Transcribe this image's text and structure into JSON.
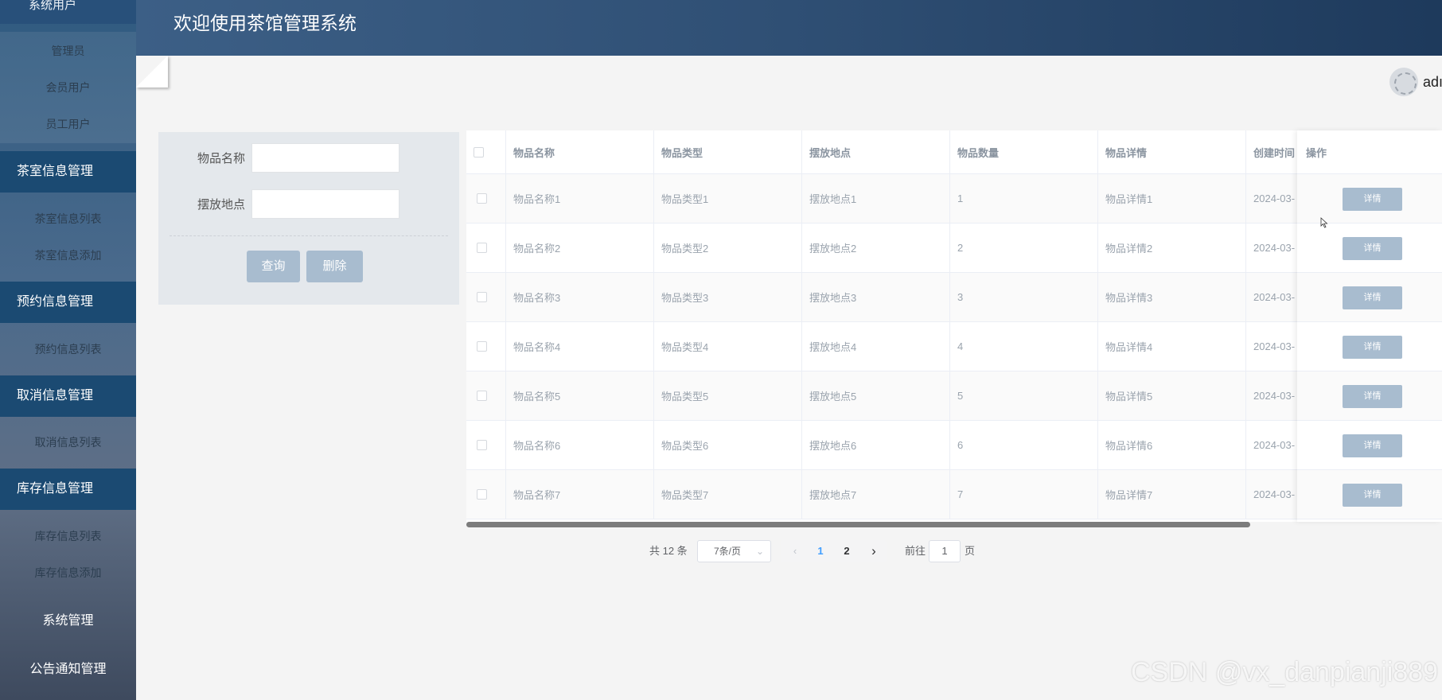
{
  "sidebar": {
    "top_item": "系统用户",
    "user_sub": [
      "管理员",
      "会员用户",
      "员工用户"
    ],
    "groups": [
      {
        "label": "茶室信息管理",
        "items": [
          "茶室信息列表",
          "茶室信息添加"
        ]
      },
      {
        "label": "预约信息管理",
        "items": [
          "预约信息列表"
        ]
      },
      {
        "label": "取消信息管理",
        "items": [
          "取消信息列表"
        ]
      },
      {
        "label": "库存信息管理",
        "items": [
          "库存信息列表",
          "库存信息添加"
        ]
      }
    ],
    "system": "系统管理",
    "notice": "公告通知管理"
  },
  "header": {
    "title": "欢迎使用茶馆管理系统"
  },
  "user": {
    "name": "adı"
  },
  "search": {
    "name_label": "物品名称",
    "name_value": "",
    "place_label": "摆放地点",
    "place_value": "",
    "query_btn": "查询",
    "delete_btn": "删除"
  },
  "table": {
    "headers": [
      "物品名称",
      "物品类型",
      "摆放地点",
      "物品数量",
      "物品详情",
      "创建时间",
      "操作"
    ],
    "rows": [
      {
        "name": "物品名称1",
        "type": "物品类型1",
        "place": "摆放地点1",
        "qty": "1",
        "detail": "物品详情1",
        "created": "2024-03-"
      },
      {
        "name": "物品名称2",
        "type": "物品类型2",
        "place": "摆放地点2",
        "qty": "2",
        "detail": "物品详情2",
        "created": "2024-03-"
      },
      {
        "name": "物品名称3",
        "type": "物品类型3",
        "place": "摆放地点3",
        "qty": "3",
        "detail": "物品详情3",
        "created": "2024-03-"
      },
      {
        "name": "物品名称4",
        "type": "物品类型4",
        "place": "摆放地点4",
        "qty": "4",
        "detail": "物品详情4",
        "created": "2024-03-"
      },
      {
        "name": "物品名称5",
        "type": "物品类型5",
        "place": "摆放地点5",
        "qty": "5",
        "detail": "物品详情5",
        "created": "2024-03-"
      },
      {
        "name": "物品名称6",
        "type": "物品类型6",
        "place": "摆放地点6",
        "qty": "6",
        "detail": "物品详情6",
        "created": "2024-03-"
      },
      {
        "name": "物品名称7",
        "type": "物品类型7",
        "place": "摆放地点7",
        "qty": "7",
        "detail": "物品详情7",
        "created": "2024-03-"
      }
    ],
    "detail_btn": "详情"
  },
  "pagination": {
    "total": "共 12 条",
    "page_size": "7条/页",
    "pages": [
      "1",
      "2"
    ],
    "current": "1",
    "jump_prefix": "前往",
    "jump_value": "1",
    "jump_suffix": "页"
  },
  "watermark": "CSDN @vx_danpianji889",
  "colors": {
    "header": "#2f4f74",
    "sidebar_group": "#1b4a72",
    "button": "#a8bccf",
    "active_page": "#409eff"
  }
}
